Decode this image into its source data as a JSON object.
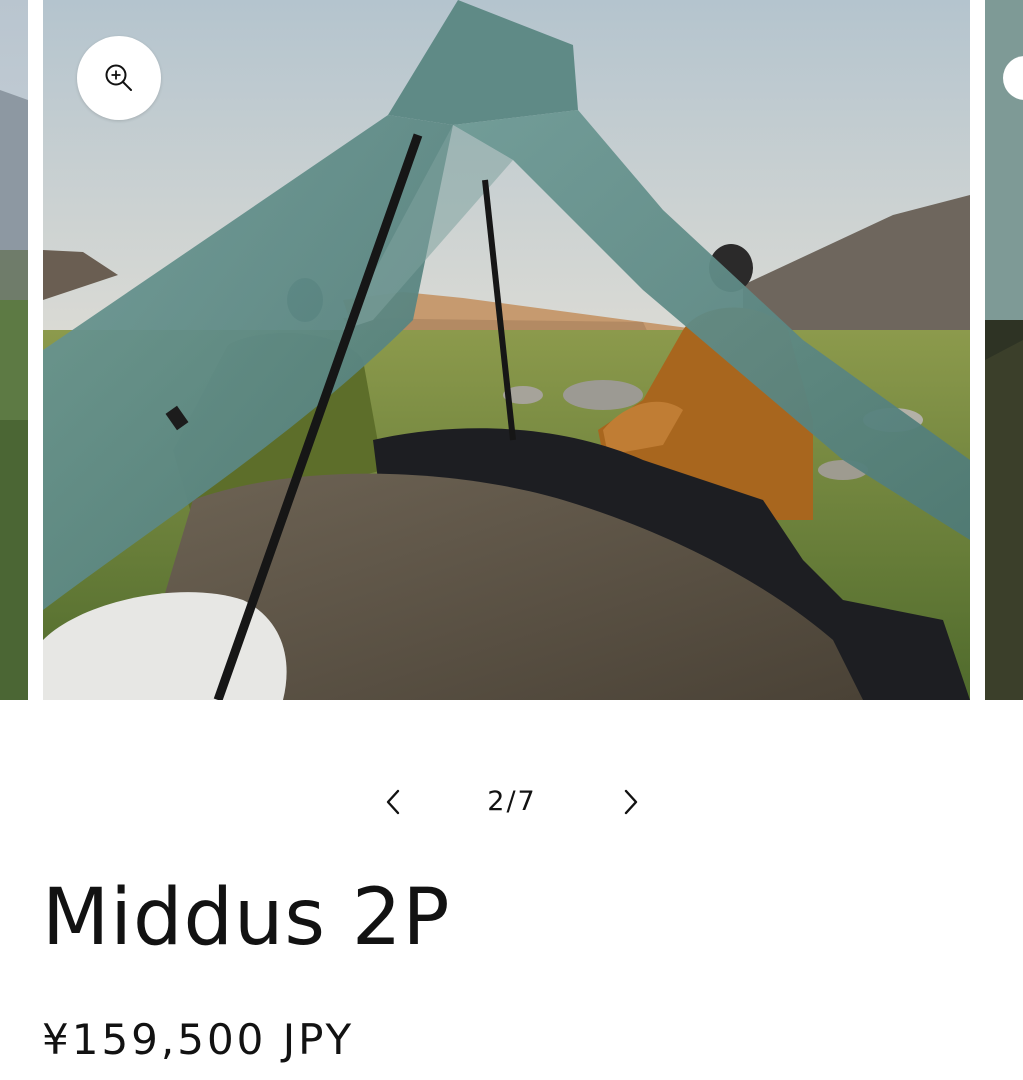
{
  "gallery": {
    "current_image": {
      "icon": "zoom-in-icon"
    },
    "pagination": {
      "counter": "2/7",
      "prev_icon": "chevron-left-icon",
      "next_icon": "chevron-right-icon"
    }
  },
  "product": {
    "title": "Middus 2P",
    "price": "¥159,500 JPY"
  },
  "colors": {
    "text": "#121212",
    "background": "#ffffff",
    "tent_fabric": "#5f8a86"
  }
}
